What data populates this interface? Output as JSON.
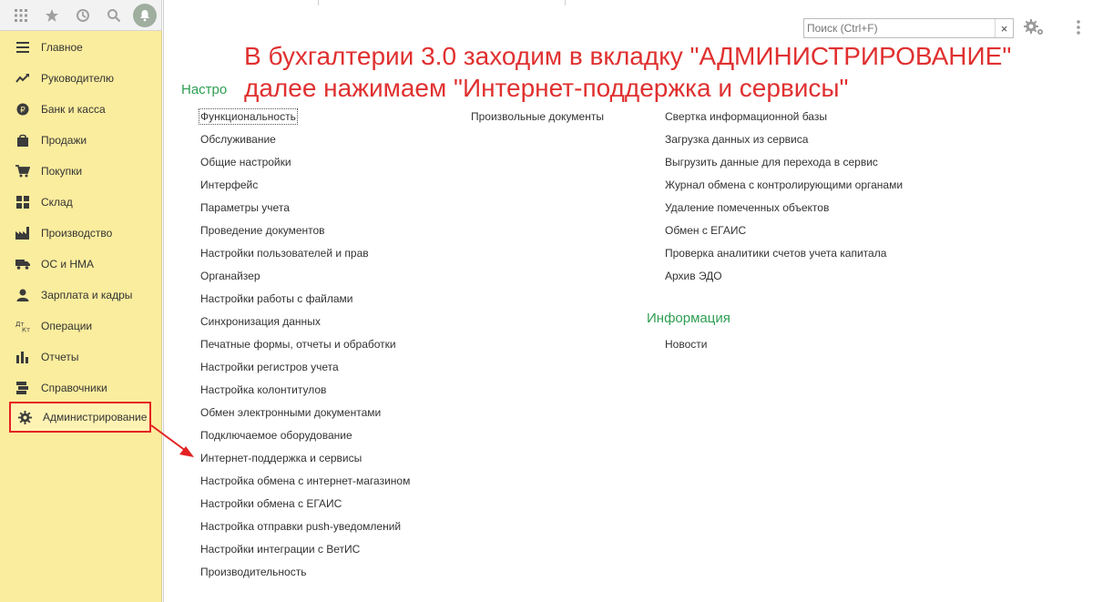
{
  "toolbar": {
    "icons": [
      "apps-grid-icon",
      "favorites-star-icon",
      "history-icon",
      "search-icon",
      "notifications-bell-icon"
    ]
  },
  "sidebar": {
    "items": [
      {
        "label": "Главное",
        "icon": "menu-list-icon"
      },
      {
        "label": "Руководителю",
        "icon": "trend-chart-icon"
      },
      {
        "label": "Банк и касса",
        "icon": "ruble-coin-icon"
      },
      {
        "label": "Продажи",
        "icon": "shopping-bag-icon"
      },
      {
        "label": "Покупки",
        "icon": "cart-icon"
      },
      {
        "label": "Склад",
        "icon": "warehouse-boxes-icon"
      },
      {
        "label": "Производство",
        "icon": "factory-icon"
      },
      {
        "label": "ОС и НМА",
        "icon": "truck-icon"
      },
      {
        "label": "Зарплата и кадры",
        "icon": "person-icon"
      },
      {
        "label": "Операции",
        "icon": "dt-kt-icon"
      },
      {
        "label": "Отчеты",
        "icon": "bar-chart-icon"
      },
      {
        "label": "Справочники",
        "icon": "books-icon"
      },
      {
        "label": "Администрирование",
        "icon": "gear-icon",
        "active": true
      }
    ],
    "colors": {
      "background": "#fbed9e",
      "highlight_border": "#e32222"
    }
  },
  "search": {
    "placeholder": "Поиск (Ctrl+F)",
    "clear_label": "×"
  },
  "annotation": {
    "line1": "В бухгалтерии 3.0 заходим в вкладку \"АДМИНИСТРИРОВАНИЕ\"",
    "line2": "далее нажимаем \"Интернет-поддержка и сервисы\"",
    "color": "#e03030"
  },
  "groups": {
    "settings_title": "Настро",
    "col1": [
      "Функциональность",
      "Обслуживание",
      "Общие настройки",
      "Интерфейс",
      "Параметры учета",
      "Проведение документов",
      "Настройки пользователей и прав",
      "Органайзер",
      "Настройки работы с файлами",
      "Синхронизация данных",
      "Печатные формы, отчеты и обработки",
      "Настройки регистров учета",
      "Настройка колонтитулов",
      "Обмен электронными документами",
      "Подключаемое оборудование",
      "Интернет-поддержка и сервисы",
      "Настройка обмена с интернет-магазином",
      "Настройки обмена с ЕГАИС",
      "Настройка отправки push-уведомлений",
      "Настройки интеграции с ВетИС",
      "Производительность"
    ],
    "col2": [
      "Произвольные документы"
    ],
    "col3": [
      "Свертка информационной базы",
      "Загрузка данных из сервиса",
      "Выгрузить данные для перехода в сервис",
      "Журнал обмена с контролирующими органами",
      "Удаление помеченных объектов",
      "Обмен с ЕГАИС",
      "Проверка аналитики счетов учета капитала",
      "Архив ЭДО"
    ],
    "info_title": "Информация",
    "info_items": [
      "Новости"
    ],
    "title_color": "#2e9e52"
  }
}
